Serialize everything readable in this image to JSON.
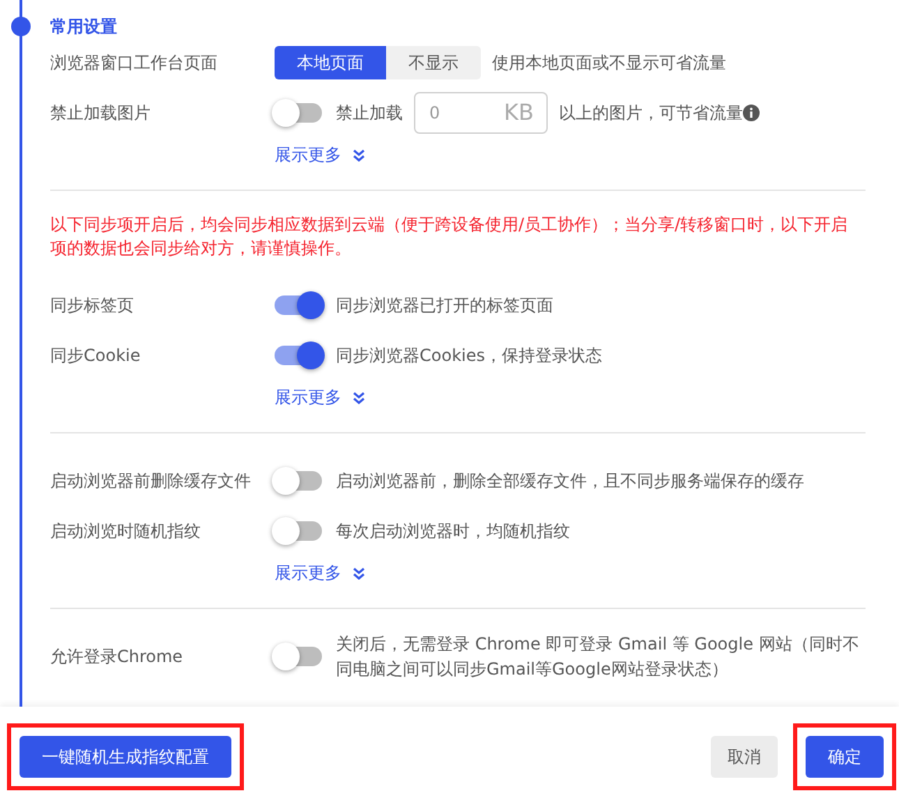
{
  "section": {
    "title": "常用设置"
  },
  "groups": [
    {
      "rows": [
        {
          "kind": "segmented",
          "label": "浏览器窗口工作台页面",
          "options": [
            {
              "label": "本地页面",
              "selected": true
            },
            {
              "label": "不显示",
              "selected": false
            }
          ],
          "description": "使用本地页面或不显示可省流量"
        },
        {
          "kind": "toggle_input",
          "label": "禁止加载图片",
          "on": false,
          "toggle_label": "禁止加载",
          "placeholder": "0",
          "unit": "KB",
          "description": "以上的图片，可节省流量",
          "info": true
        }
      ],
      "more": "展示更多"
    },
    {
      "notice": "以下同步项开启后，均会同步相应数据到云端（便于跨设备使用/员工协作）；当分享/转移窗口时，以下开启项的数据也会同步给对方，请谨慎操作。",
      "rows": [
        {
          "kind": "toggle",
          "label": "同步标签页",
          "on": true,
          "description": "同步浏览器已打开的标签页面"
        },
        {
          "kind": "toggle",
          "label": "同步Cookie",
          "on": true,
          "description": "同步浏览器Cookies，保持登录状态"
        }
      ],
      "more": "展示更多"
    },
    {
      "rows": [
        {
          "kind": "toggle",
          "label": "启动浏览器前删除缓存文件",
          "on": false,
          "description": "启动浏览器前，删除全部缓存文件，且不同步服务端保存的缓存"
        },
        {
          "kind": "toggle",
          "label": "启动浏览时随机指纹",
          "on": false,
          "description": "每次启动浏览器时，均随机指纹"
        }
      ],
      "more": "展示更多"
    },
    {
      "rows": [
        {
          "kind": "toggle",
          "label": "允许登录Chrome",
          "on": false,
          "description": "关闭后，无需登录 Chrome 即可登录 Gmail 等 Google 网站（同时不同电脑之间可以同步Gmail等Google网站登录状态）"
        }
      ]
    }
  ],
  "footer": {
    "buttons": [
      {
        "label": "一键随机生成指纹配置",
        "kind": "primary",
        "highlighted": true
      },
      {
        "label": "取消",
        "kind": "secondary",
        "highlighted": false
      },
      {
        "label": "确定",
        "kind": "primary",
        "highlighted": true
      }
    ]
  }
}
